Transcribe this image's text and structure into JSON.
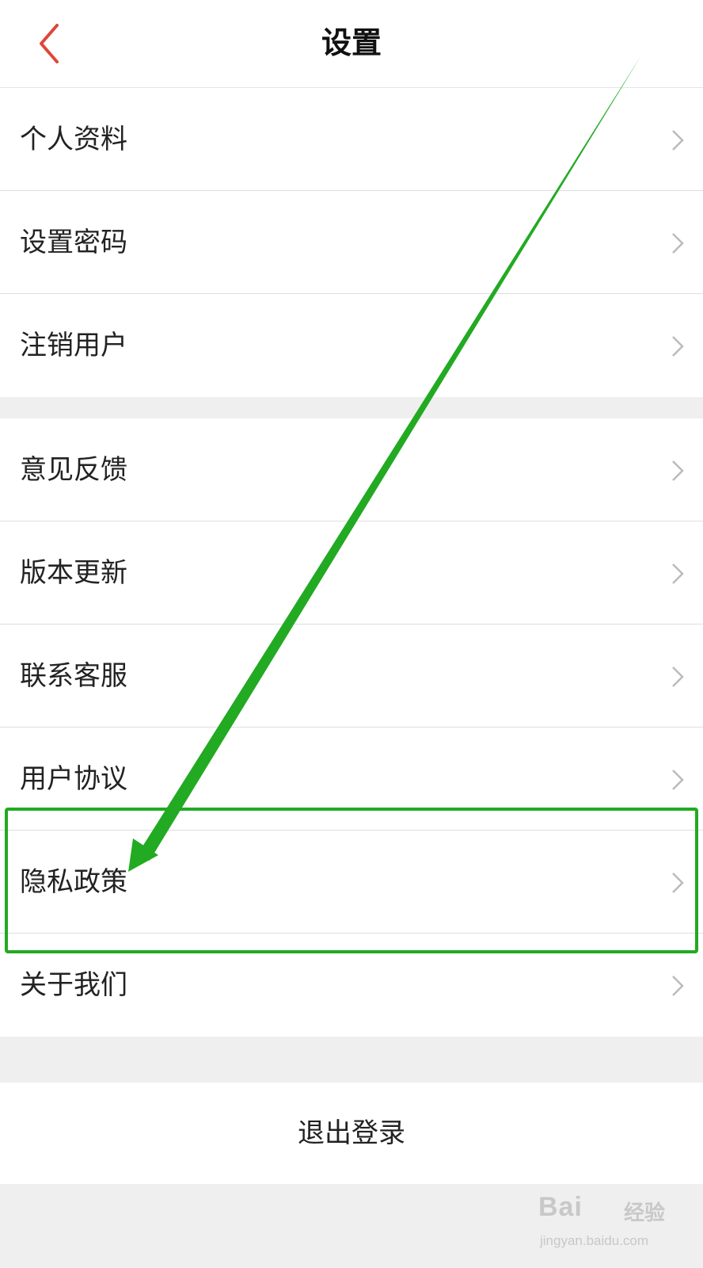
{
  "header": {
    "title": "设置",
    "back_icon": "chevron-left-icon",
    "back_color": "#e0453a"
  },
  "groups": [
    {
      "items": [
        {
          "label": "个人资料"
        },
        {
          "label": "设置密码"
        },
        {
          "label": "注销用户"
        }
      ]
    },
    {
      "items": [
        {
          "label": "意见反馈"
        },
        {
          "label": "版本更新"
        },
        {
          "label": "联系客服"
        },
        {
          "label": "用户协议"
        },
        {
          "label": "隐私政策"
        },
        {
          "label": "关于我们"
        }
      ]
    }
  ],
  "logout_label": "退出登录",
  "annotation": {
    "type": "arrow-and-highlight-box",
    "color": "#22aa22",
    "highlighted_item": "隐私政策"
  },
  "watermark": {
    "main": "Bai",
    "cn": "经验",
    "url": "jingyan.baidu.com"
  },
  "colors": {
    "background": "#efefef",
    "surface": "#ffffff",
    "divider": "#dedede",
    "chevron": "#bbbbbb",
    "accent": "#e0453a"
  }
}
